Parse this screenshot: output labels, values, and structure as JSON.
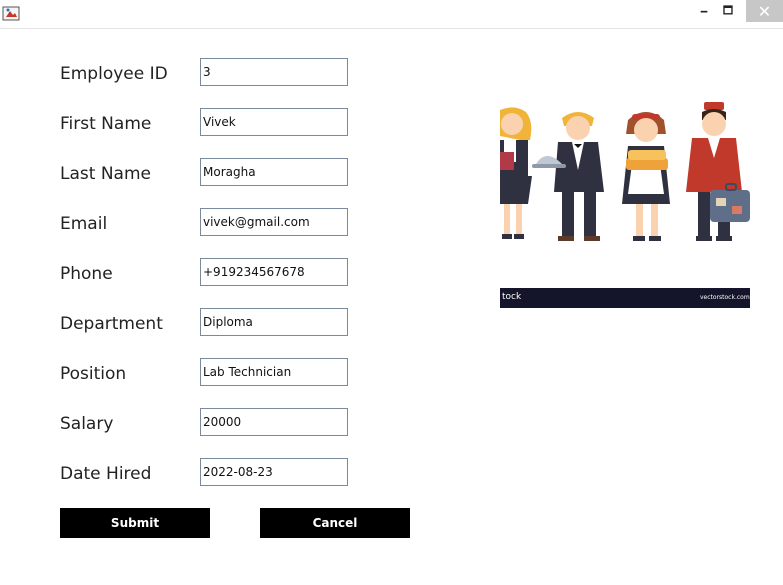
{
  "window": {
    "minimize_glyph": "🗕",
    "maximize_glyph": "🗖",
    "close_glyph": "✕"
  },
  "form": {
    "fields": [
      {
        "label": "Employee ID",
        "value": "3"
      },
      {
        "label": "First Name",
        "value": "Vivek"
      },
      {
        "label": "Last Name",
        "value": "Moragha"
      },
      {
        "label": "Email",
        "value": "vivek@gmail.com"
      },
      {
        "label": "Phone",
        "value": "+919234567678"
      },
      {
        "label": "Department",
        "value": "Diploma"
      },
      {
        "label": "Position",
        "value": "Lab Technician"
      },
      {
        "label": "Salary",
        "value": "20000"
      },
      {
        "label": "Date Hired",
        "value": "2022-08-23"
      }
    ],
    "submit_label": "Submit",
    "cancel_label": "Cancel"
  },
  "illustration": {
    "watermark_left": "tock",
    "watermark_right": "vectorstock.com"
  },
  "colors": {
    "button_bg": "#000000",
    "button_text": "#ffffff",
    "input_border": "#7a8a9a"
  }
}
